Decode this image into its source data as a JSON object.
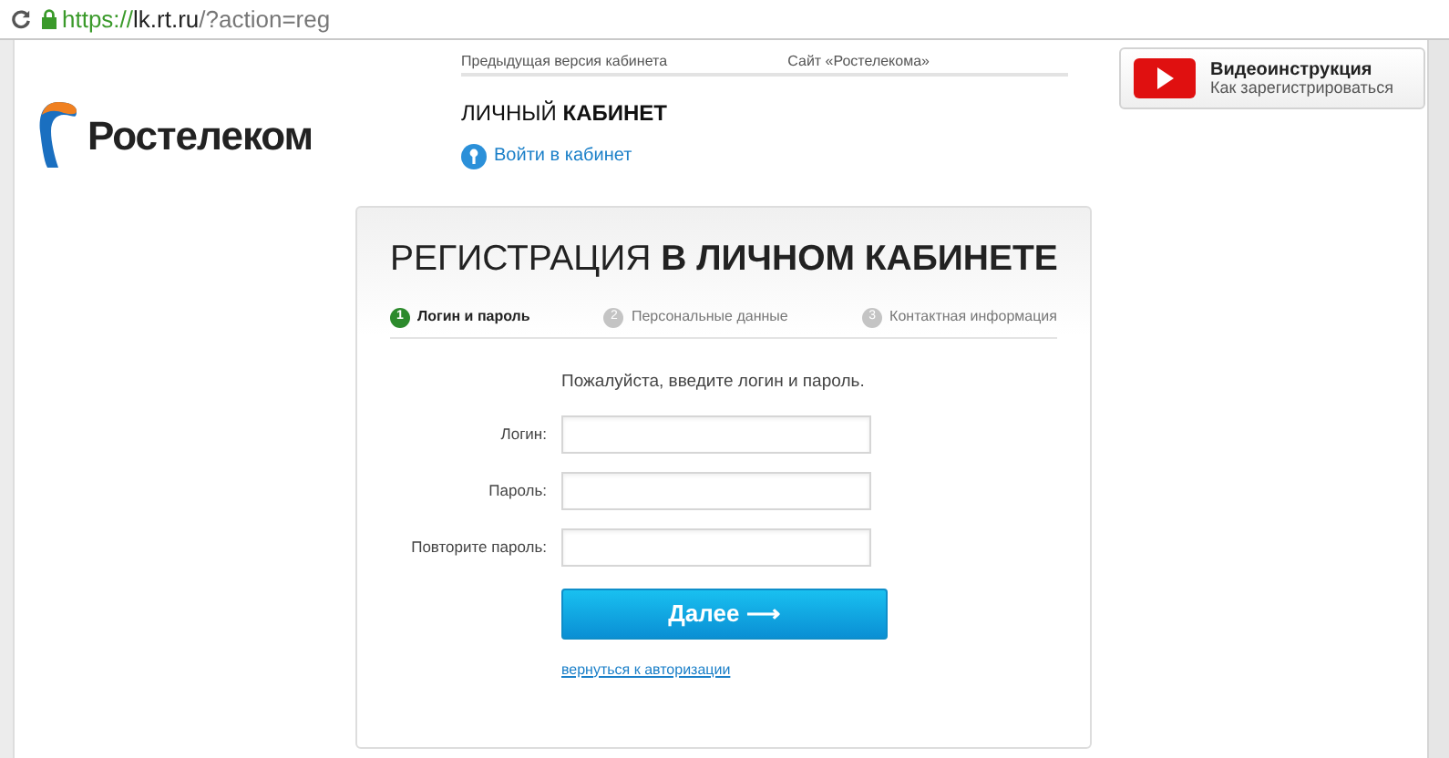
{
  "address_bar": {
    "secure_part": "https://",
    "host": "lk.rt.ru",
    "path": "/?action=reg"
  },
  "top_links": [
    "Предыдущая версия кабинета",
    "Сайт «Ростелекома»"
  ],
  "logo": {
    "text": "Ростелеком"
  },
  "cabinet": {
    "title": "ЛИЧНЫЙ **КАБИНЕТ**",
    "login_link": "Войти в кабинет"
  },
  "video": {
    "title": "Видеоинструкция",
    "subtitle": "Как зарегистрироваться"
  },
  "form": {
    "title": "РЕГИСТРАЦИЯ **В ЛИЧНОМ КАБИНЕТЕ**",
    "steps": [
      {
        "number": "1",
        "label": "Логин и пароль",
        "selected": true
      },
      {
        "number": "2",
        "label": "Персональные данные",
        "selected": false
      },
      {
        "number": "3",
        "label": "Контактная информация",
        "selected": false
      }
    ],
    "prompt": "Пожалуйста, введите логин и пароль.",
    "fields": [
      {
        "label": "Логин:"
      },
      {
        "label": "Пароль:"
      },
      {
        "label": "Повторите пароль:"
      }
    ],
    "submit": "Далее ⟶",
    "back_link": "вернуться к авторизации"
  }
}
